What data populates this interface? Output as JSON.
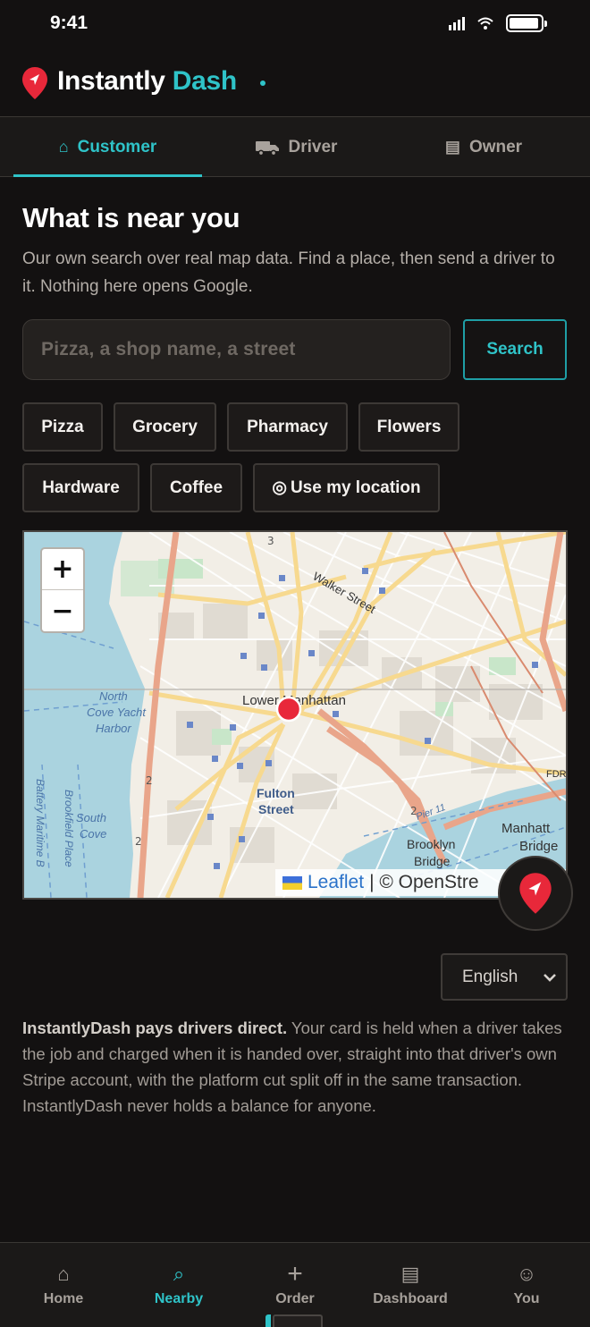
{
  "status_bar": {
    "time": "9:41"
  },
  "header": {
    "brand_first": "Instantly",
    "brand_second": "Dash",
    "colors": {
      "accent": "#2fc3c8",
      "pin": "#e8283a"
    }
  },
  "role_tabs": [
    {
      "label": "Customer",
      "icon": "home-outline-icon",
      "glyph": "⌂",
      "active": true
    },
    {
      "label": "Driver",
      "icon": "truck-icon",
      "glyph": "",
      "active": false
    },
    {
      "label": "Owner",
      "icon": "list-icon",
      "glyph": "▤",
      "active": false
    }
  ],
  "main": {
    "title": "What is near you",
    "subtitle": "Our own search over real map data. Find a place, then send a driver to it. Nothing here opens Google."
  },
  "search": {
    "placeholder": "Pizza, a shop name, a street",
    "value": "",
    "button_label": "Search"
  },
  "chips": [
    {
      "label": "Pizza"
    },
    {
      "label": "Grocery"
    },
    {
      "label": "Pharmacy"
    },
    {
      "label": "Flowers"
    },
    {
      "label": "Hardware"
    },
    {
      "label": "Coffee"
    },
    {
      "label": "Use my location",
      "icon": "target-icon",
      "glyph": "◎"
    }
  ],
  "map": {
    "zoom_in": "+",
    "zoom_out": "−",
    "labels": {
      "walker_street": "Walker Street",
      "lower_manhattan": "Lower Manhattan",
      "north_cove_1": "North",
      "north_cove_2": "Cove Yacht",
      "north_cove_3": "Harbor",
      "fulton_1": "Fulton",
      "fulton_2": "Street",
      "south_cove_1": "South",
      "south_cove_2": "Cove",
      "battery": "Battery Maritime B",
      "brookfield": "Brookfield Place",
      "brooklyn_bridge_1": "Brooklyn",
      "brooklyn_bridge_2": "Bridge",
      "manhattan_bridge_1": "Manhatt",
      "manhattan_bridge_2": "Bridge",
      "fdr": "FDR",
      "pier": "Pier 11",
      "route_2a": "2",
      "route_2b": "2",
      "route_2c": "2",
      "route_3": "3"
    },
    "attribution_leaflet": "Leaflet",
    "attribution_rest": "| © OpenStre",
    "colors": {
      "marker": "#e8283a",
      "water": "#aad3df",
      "road_major": "#f7d98f",
      "road_primary": "#e9a58a"
    }
  },
  "language": {
    "selected": "English"
  },
  "notice": {
    "bold": "InstantlyDash pays drivers direct.",
    "text": " Your card is held when a driver takes the job and charged when it is handed over, straight into that driver's own Stripe account, with the platform cut split off in the same transaction. InstantlyDash never holds a balance for anyone."
  },
  "bottom_nav": [
    {
      "label": "Home",
      "icon": "home-icon",
      "glyph": "⌂",
      "active": false
    },
    {
      "label": "Nearby",
      "icon": "search-icon",
      "glyph": "⌕",
      "active": true
    },
    {
      "label": "Order",
      "icon": "plus-icon",
      "glyph": "+",
      "active": false
    },
    {
      "label": "Dashboard",
      "icon": "dashboard-icon",
      "glyph": "▤",
      "active": false
    },
    {
      "label": "You",
      "icon": "smiley-icon",
      "glyph": "☺",
      "active": false
    }
  ]
}
